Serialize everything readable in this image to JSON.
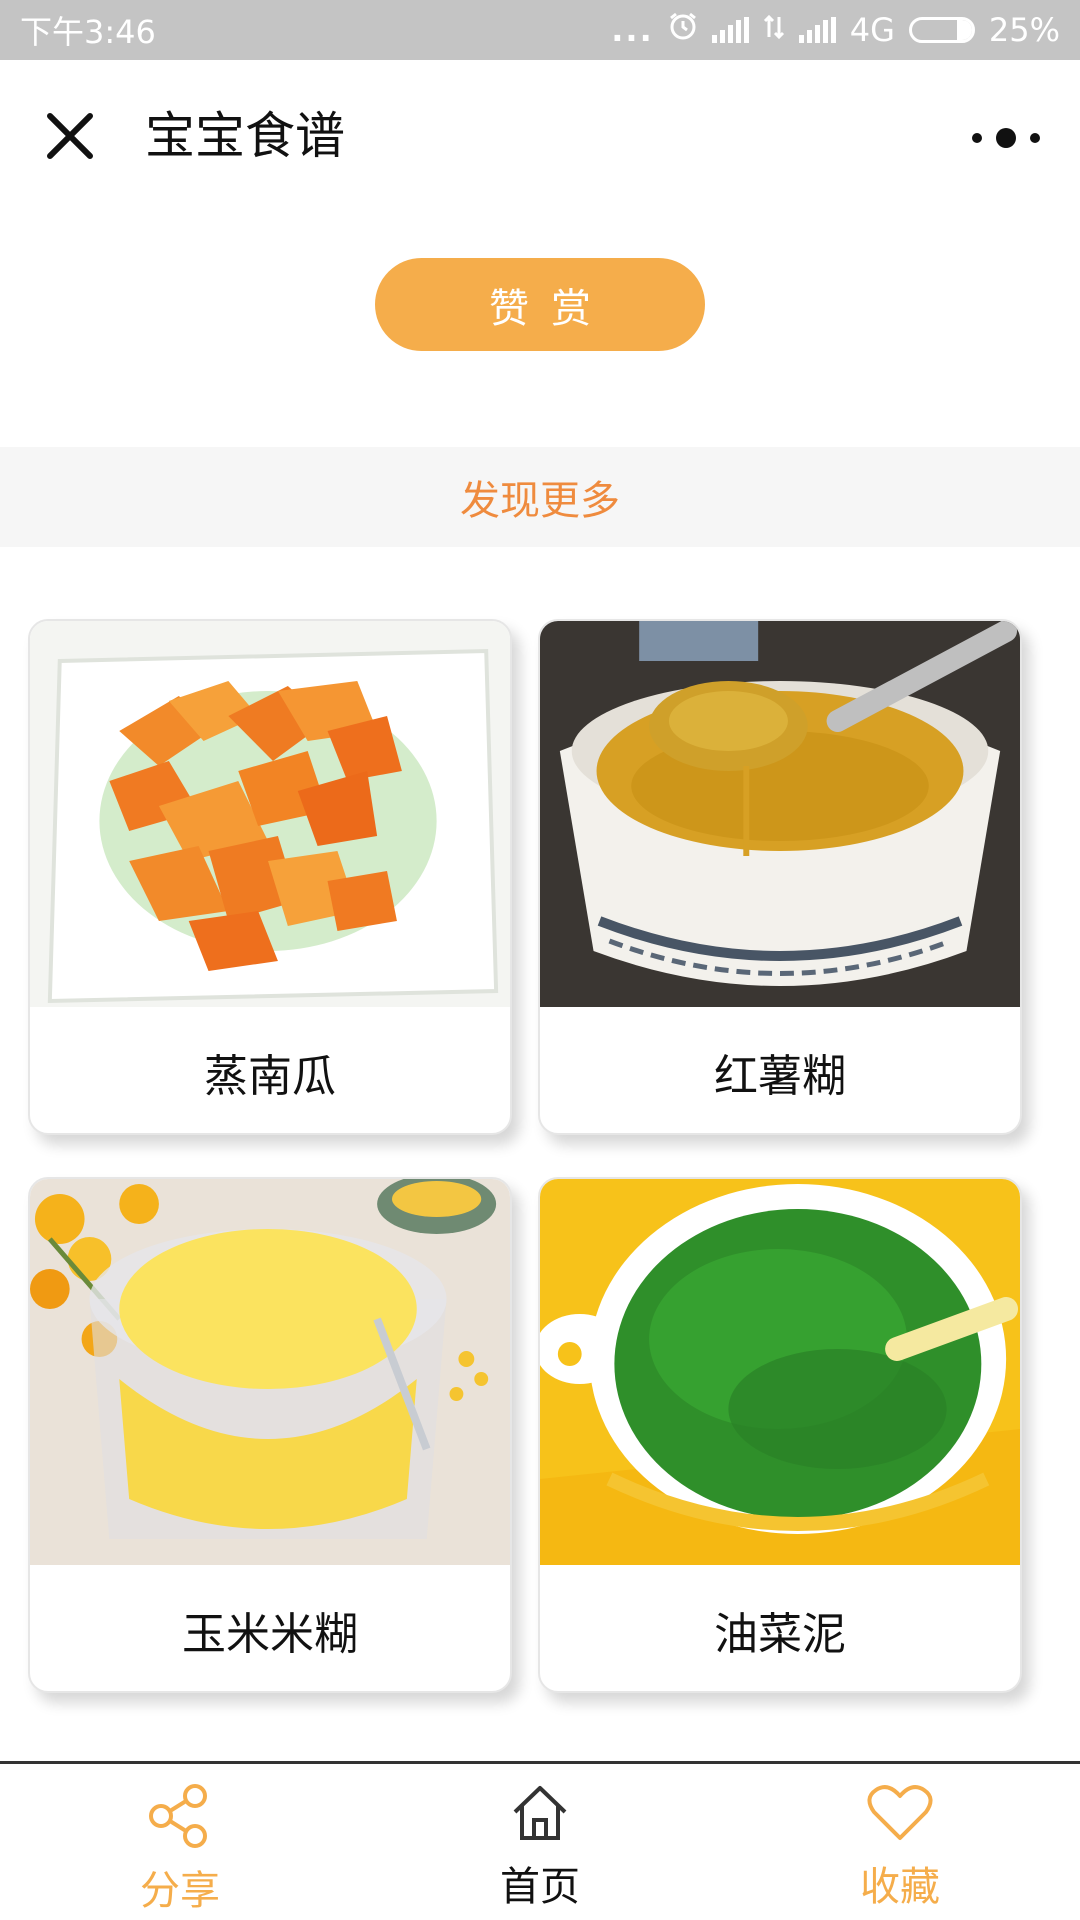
{
  "status_bar": {
    "time": "下午3:46",
    "dots": "...",
    "network": "4G",
    "battery_text": "25%",
    "battery_level": 0.25
  },
  "nav": {
    "title": "宝宝食谱"
  },
  "reward_button": {
    "label": "赞赏",
    "color": "#f5ad4b"
  },
  "discover": {
    "label": "发现更多",
    "color": "#ef8b3e"
  },
  "recipes": [
    {
      "name": "蒸南瓜"
    },
    {
      "name": "红薯糊"
    },
    {
      "name": "玉米米糊"
    },
    {
      "name": "油菜泥"
    }
  ],
  "tab_bar": {
    "tabs": [
      {
        "label": "分享",
        "icon": "share-icon",
        "color": "#f5ad4b"
      },
      {
        "label": "首页",
        "icon": "home-icon",
        "color": "#111111"
      },
      {
        "label": "收藏",
        "icon": "heart-icon",
        "color": "#f5ad4b"
      }
    ]
  }
}
